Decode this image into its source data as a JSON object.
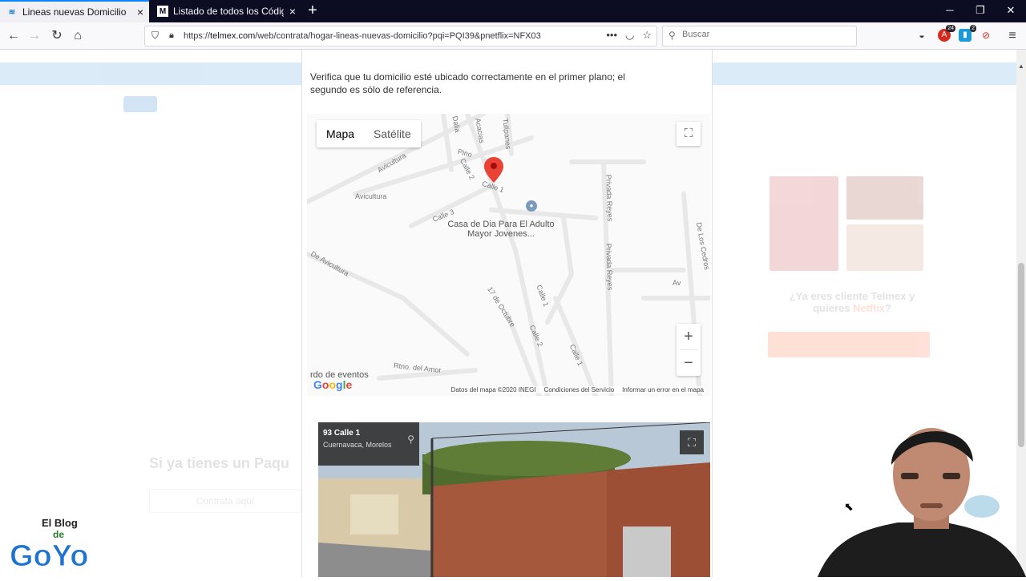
{
  "browser": {
    "tabs": [
      {
        "title": "Lineas nuevas Domicilio",
        "active": true
      },
      {
        "title": "Listado de todos los Códigos P",
        "active": false
      }
    ],
    "url_prefix": "https://",
    "url_domain": "telmex.com",
    "url_path": "/web/contrata/hogar-lineas-nuevas-domicilio?pqi=PQI39&pnetflix=NFX03",
    "search_placeholder": "Buscar",
    "ext_badges": {
      "abp": "24",
      "blue": "2"
    }
  },
  "modal": {
    "instructions": "Verifica que tu domicilio esté ubicado correctamente en el primer plano; el segundo es sólo de referencia.",
    "map": {
      "type_map": "Mapa",
      "type_satellite": "Satélite",
      "zoom_in": "+",
      "zoom_out": "−",
      "poi": "Casa de Dia Para El Adulto Mayor Jovenes...",
      "poi_cut": "rdo de eventos",
      "streets": [
        "Dalia",
        "Acacias",
        "Tulipanes",
        "Pino",
        "Avicultura",
        "Calle 2",
        "Calle 1",
        "Avicultura",
        "Privada Reyes",
        "Calle 3",
        "De Los Cedros",
        "De Avicultura",
        "Privada Reyes",
        "Calle 1",
        "17 de Octubre",
        "Calle 2",
        "Calle 1",
        "Rtno. del Amor",
        "Av"
      ],
      "footer": [
        "Datos del mapa ©2020 INEGI",
        "Condiciones del Servicio",
        "Informar un error en el mapa"
      ],
      "logo": "Google"
    },
    "streetview": {
      "address": "93 Calle 1",
      "city": "Cuernavaca, Morelos"
    }
  },
  "background": {
    "title": "Si ya tienes un Paqu",
    "button": "Contrata aquí",
    "question_1": "¿Ya eres cliente Telmex y",
    "question_2": "quieres",
    "question_highlight": "Netflix",
    "question_end": "?"
  },
  "overlay": {
    "blog_line1": "El Blog",
    "blog_line2": "de",
    "blog_line3": "GoYo"
  },
  "colors": {
    "tabstrip": "#0c0c23",
    "accent": "#0a84ff",
    "pin": "#ea4335",
    "telmex_blue": "#3c8fd6",
    "orange": "#ff5a2a"
  }
}
